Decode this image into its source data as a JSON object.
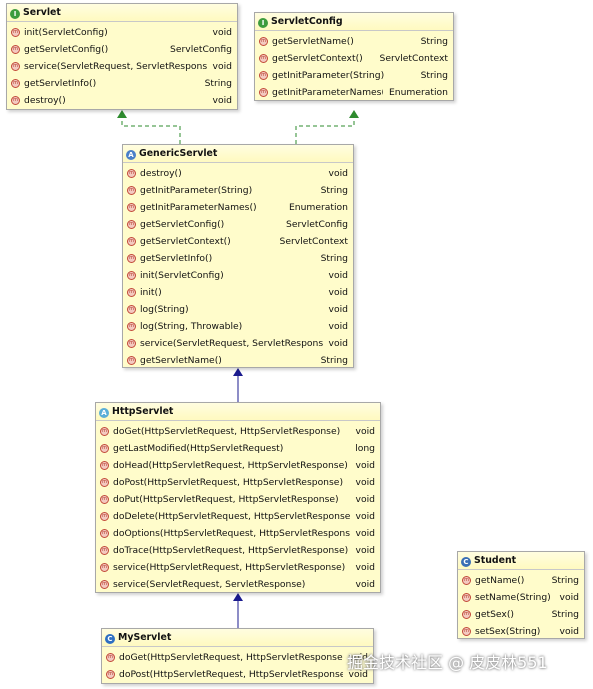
{
  "servlet": {
    "name": "Servlet",
    "icon": "interface-icon",
    "methods": [
      {
        "sig": "init(ServletConfig)",
        "ret": "void"
      },
      {
        "sig": "getServletConfig()",
        "ret": "ServletConfig"
      },
      {
        "sig": "service(ServletRequest, ServletResponse)",
        "ret": "void"
      },
      {
        "sig": "getServletInfo()",
        "ret": "String"
      },
      {
        "sig": "destroy()",
        "ret": "void"
      }
    ]
  },
  "servletConfig": {
    "name": "ServletConfig",
    "icon": "interface-icon",
    "methods": [
      {
        "sig": "getServletName()",
        "ret": "String"
      },
      {
        "sig": "getServletContext()",
        "ret": "ServletContext"
      },
      {
        "sig": "getInitParameter(String)",
        "ret": "String"
      },
      {
        "sig": "getInitParameterNames()",
        "ret": "Enumeration"
      }
    ]
  },
  "genericServlet": {
    "name": "GenericServlet",
    "icon": "abstract-class-icon",
    "methods": [
      {
        "sig": "destroy()",
        "ret": "void"
      },
      {
        "sig": "getInitParameter(String)",
        "ret": "String"
      },
      {
        "sig": "getInitParameterNames()",
        "ret": "Enumeration"
      },
      {
        "sig": "getServletConfig()",
        "ret": "ServletConfig"
      },
      {
        "sig": "getServletContext()",
        "ret": "ServletContext"
      },
      {
        "sig": "getServletInfo()",
        "ret": "String"
      },
      {
        "sig": "init(ServletConfig)",
        "ret": "void"
      },
      {
        "sig": "init()",
        "ret": "void"
      },
      {
        "sig": "log(String)",
        "ret": "void"
      },
      {
        "sig": "log(String, Throwable)",
        "ret": "void"
      },
      {
        "sig": "service(ServletRequest, ServletResponse)",
        "ret": "void"
      },
      {
        "sig": "getServletName()",
        "ret": "String"
      }
    ]
  },
  "httpServlet": {
    "name": "HttpServlet",
    "icon": "abstract-class-icon",
    "methods": [
      {
        "sig": "doGet(HttpServletRequest, HttpServletResponse)",
        "ret": "void"
      },
      {
        "sig": "getLastModified(HttpServletRequest)",
        "ret": "long"
      },
      {
        "sig": "doHead(HttpServletRequest, HttpServletResponse)",
        "ret": "void"
      },
      {
        "sig": "doPost(HttpServletRequest, HttpServletResponse)",
        "ret": "void"
      },
      {
        "sig": "doPut(HttpServletRequest, HttpServletResponse)",
        "ret": "void"
      },
      {
        "sig": "doDelete(HttpServletRequest, HttpServletResponse)",
        "ret": "void"
      },
      {
        "sig": "doOptions(HttpServletRequest, HttpServletResponse)",
        "ret": "void"
      },
      {
        "sig": "doTrace(HttpServletRequest, HttpServletResponse)",
        "ret": "void"
      },
      {
        "sig": "service(HttpServletRequest, HttpServletResponse)",
        "ret": "void"
      },
      {
        "sig": "service(ServletRequest, ServletResponse)",
        "ret": "void"
      }
    ]
  },
  "myServlet": {
    "name": "MyServlet",
    "icon": "class-icon",
    "methods": [
      {
        "sig": "doGet(HttpServletRequest, HttpServletResponse)",
        "ret": "void"
      },
      {
        "sig": "doPost(HttpServletRequest, HttpServletResponse)",
        "ret": "void"
      }
    ]
  },
  "student": {
    "name": "Student",
    "icon": "class-icon",
    "methods": [
      {
        "sig": "getName()",
        "ret": "String"
      },
      {
        "sig": "setName(String)",
        "ret": "void"
      },
      {
        "sig": "getSex()",
        "ret": "String"
      },
      {
        "sig": "setSex(String)",
        "ret": "void"
      }
    ]
  },
  "relations": [
    {
      "from": "GenericServlet",
      "to": "Servlet",
      "kind": "realization"
    },
    {
      "from": "GenericServlet",
      "to": "ServletConfig",
      "kind": "realization"
    },
    {
      "from": "HttpServlet",
      "to": "GenericServlet",
      "kind": "generalization"
    },
    {
      "from": "MyServlet",
      "to": "HttpServlet",
      "kind": "generalization"
    }
  ],
  "colors": {
    "box_fill": "#fffccb",
    "realization": "#2e8b2e",
    "generalization": "#1b1b8f",
    "method_icon": "#c24a3a"
  },
  "watermark": "掘金技术社区 @ 皮皮林551"
}
